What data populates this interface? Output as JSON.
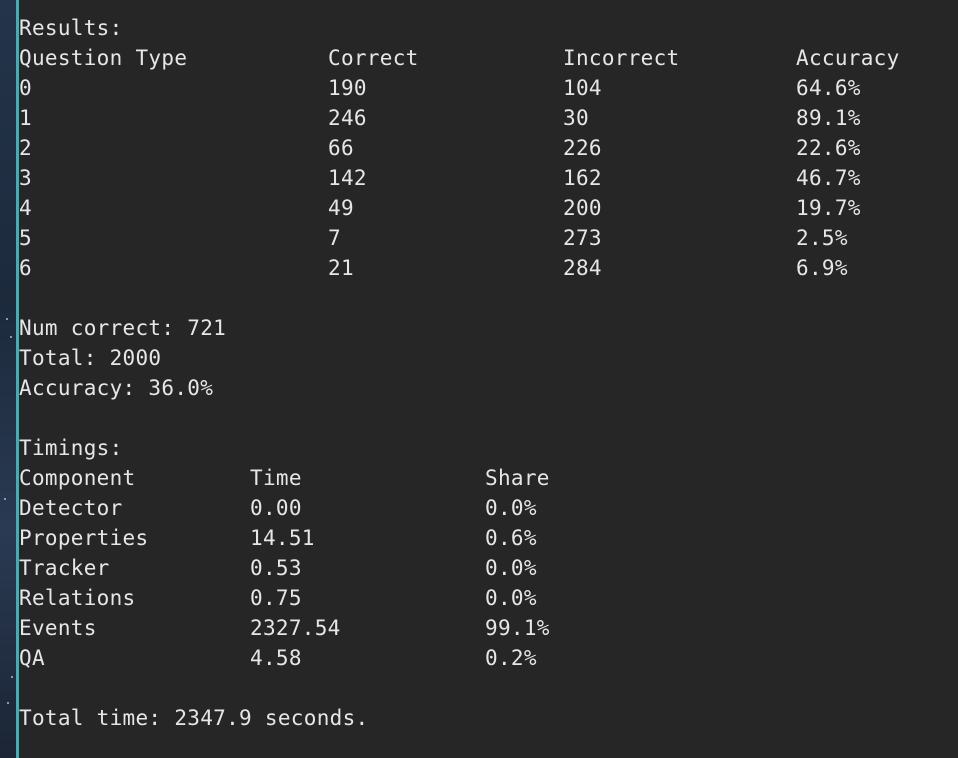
{
  "results": {
    "header": "Results:",
    "columns": [
      "Question Type",
      "Correct",
      "Incorrect",
      "Accuracy"
    ],
    "rows": [
      [
        "0",
        "190",
        "104",
        "64.6%"
      ],
      [
        "1",
        "246",
        "30",
        "89.1%"
      ],
      [
        "2",
        "66",
        "226",
        "22.6%"
      ],
      [
        "3",
        "142",
        "162",
        "46.7%"
      ],
      [
        "4",
        "49",
        "200",
        "19.7%"
      ],
      [
        "5",
        "7",
        "273",
        "2.5%"
      ],
      [
        "6",
        "21",
        "284",
        "6.9%"
      ]
    ]
  },
  "summary": {
    "num_correct": "Num correct: 721",
    "total": "Total: 2000",
    "accuracy": "Accuracy: 36.0%"
  },
  "timings": {
    "header": "Timings:",
    "columns": [
      "Component",
      "Time",
      "Share"
    ],
    "rows": [
      [
        "Detector",
        "0.00",
        "0.0%"
      ],
      [
        "Properties",
        "14.51",
        "0.6%"
      ],
      [
        "Tracker",
        "0.53",
        "0.0%"
      ],
      [
        "Relations",
        "0.75",
        "0.0%"
      ],
      [
        "Events",
        "2327.54",
        "99.1%"
      ],
      [
        "QA",
        "4.58",
        "0.2%"
      ]
    ]
  },
  "total_time": "Total time: 2347.9 seconds.",
  "colors": {
    "terminal_bg": "#262626",
    "text": "#e6e6e6",
    "accent": "#3fb0b0"
  }
}
